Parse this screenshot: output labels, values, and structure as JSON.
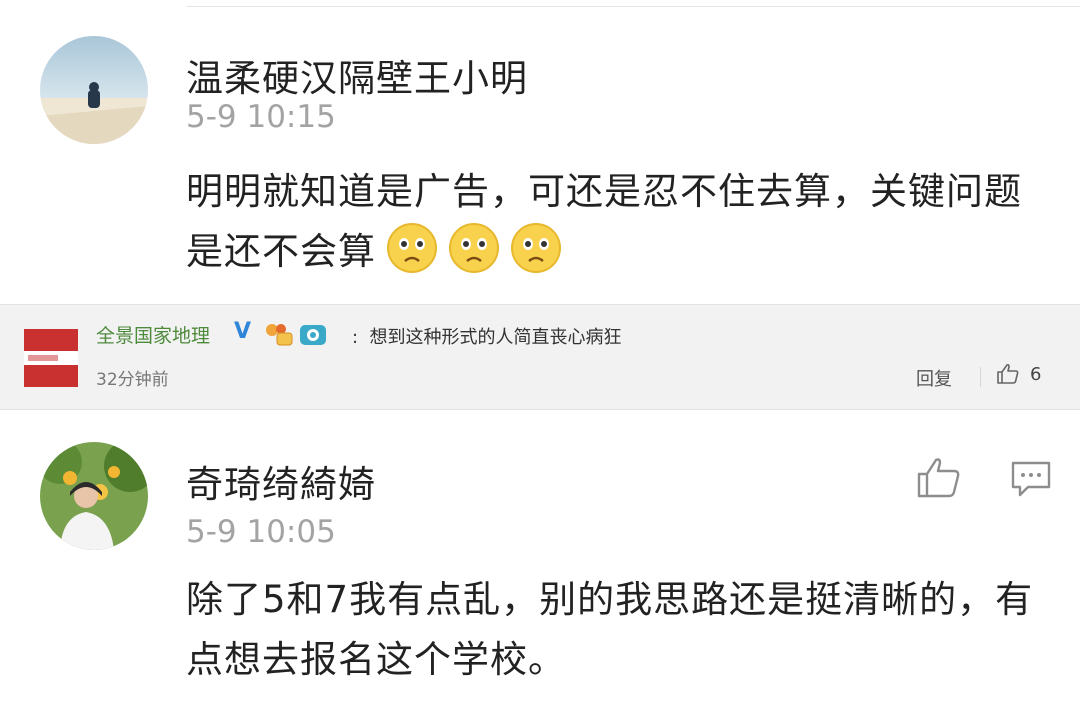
{
  "comment1": {
    "username": "温柔硬汉隔壁王小明",
    "time": "5-9 10:15",
    "text": "明明就知道是广告，可还是忍不住去算，关键问题是还不会算",
    "emojis": [
      "worried-face-icon",
      "worried-face-icon",
      "worried-face-icon"
    ]
  },
  "middle": {
    "username": "全景国家地理",
    "verified_mark": "V",
    "text": "想到这种形式的人简直丧心病狂",
    "time": "32分钟前",
    "reply_label": "回复",
    "like_count": "6"
  },
  "comment2": {
    "username": "奇琦绮綺婍",
    "time": "5-9 10:05",
    "text": "除了5和7我有点乱，别的我思路还是挺清晰的，有点想去报名这个学校。"
  },
  "colors": {
    "name_green": "#4e8a3c",
    "verified_blue": "#2f86d8",
    "muted_gray": "#a3a3a3"
  }
}
